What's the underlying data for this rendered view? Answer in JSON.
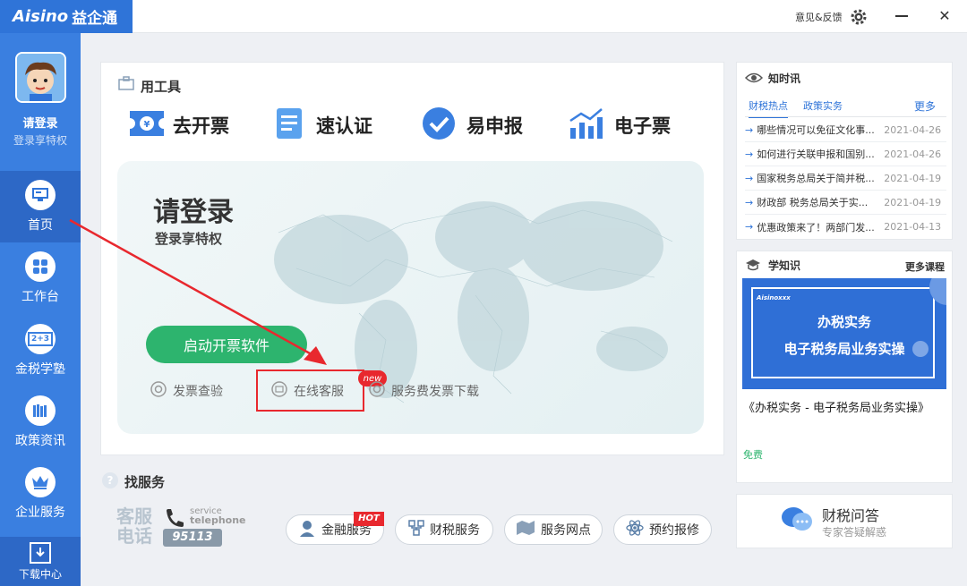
{
  "app": {
    "brand": "Aisino",
    "name": "益企通"
  },
  "titlebar": {
    "feedback": "意见&反馈"
  },
  "sidebar": {
    "user_name": "请登录",
    "user_sub": "登录享特权",
    "items": [
      {
        "label": "首页"
      },
      {
        "label": "工作台"
      },
      {
        "label": "金税学塾"
      },
      {
        "label": "政策资讯"
      },
      {
        "label": "企业服务"
      },
      {
        "label": "下载中心"
      }
    ],
    "calc_icon_text": "2+3"
  },
  "tools": {
    "title": "用工具",
    "items": [
      {
        "label": "去开票"
      },
      {
        "label": "速认证"
      },
      {
        "label": "易申报"
      },
      {
        "label": "电子票"
      }
    ]
  },
  "login": {
    "title": "请登录",
    "subtitle": "登录享特权",
    "start_button": "启动开票软件",
    "links": [
      {
        "label": "发票查验"
      },
      {
        "label": "在线客服"
      },
      {
        "label": "服务费发票下载"
      }
    ],
    "new_badge": "new"
  },
  "services": {
    "title": "找服务",
    "hotline_cn_1": "客服",
    "hotline_cn_2": "电话",
    "hotline_en_1": "service",
    "hotline_en_2": "telephone",
    "hotline_number": "95113",
    "buttons": [
      {
        "label": "金融服务"
      },
      {
        "label": "财税服务"
      },
      {
        "label": "服务网点"
      },
      {
        "label": "预约报修"
      }
    ],
    "hot_badge": "HOT"
  },
  "news": {
    "title": "知时讯",
    "tabs": [
      {
        "label": "财税热点"
      },
      {
        "label": "政策实务"
      }
    ],
    "more": "更多",
    "items": [
      {
        "title": "哪些情况可以免征文化事...",
        "date": "2021-04-26"
      },
      {
        "title": "如何进行关联申报和国别...",
        "date": "2021-04-26"
      },
      {
        "title": "国家税务总局关于简并税...",
        "date": "2021-04-19"
      },
      {
        "title": "财政部 税务总局关于实...",
        "date": "2021-04-19"
      },
      {
        "title": "优惠政策来了！两部门发...",
        "date": "2021-04-13"
      }
    ]
  },
  "learn": {
    "title": "学知识",
    "more": "更多课程",
    "banner_logo": "Aisinoxxx",
    "banner_line1": "办税实务",
    "banner_line2": "电子税务局业务实操",
    "course_title": "《办税实务 - 电子税务局业务实操》",
    "price": "免费"
  },
  "qa": {
    "title": "财税问答",
    "subtitle": "专家答疑解惑"
  },
  "colors": {
    "accent": "#3a7fe0",
    "green": "#2db46e",
    "highlight": "#e8282e"
  }
}
